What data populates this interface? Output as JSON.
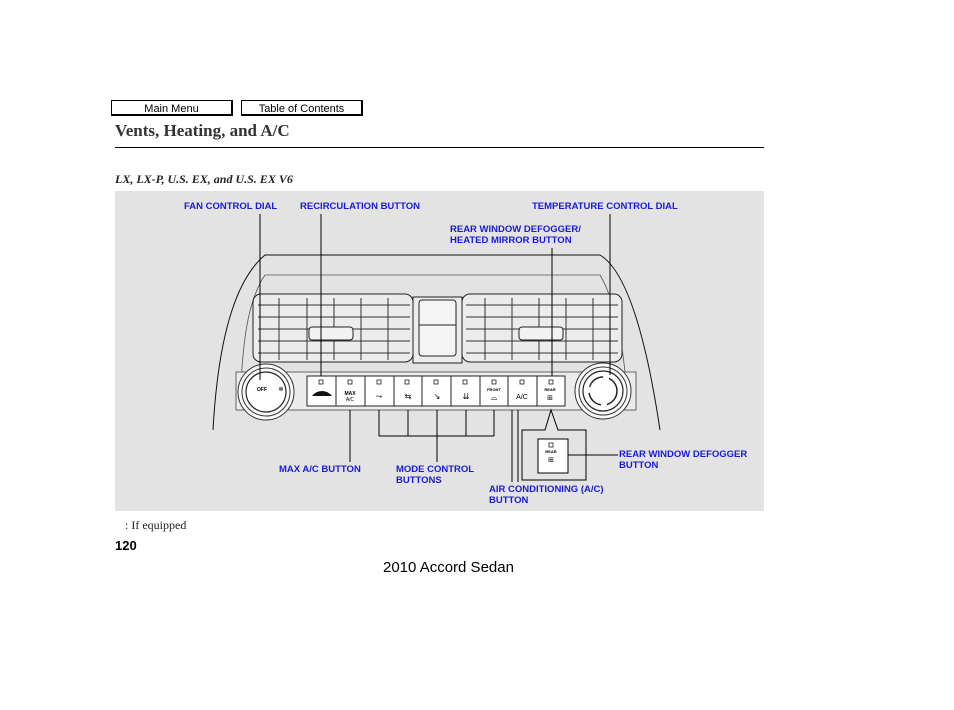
{
  "nav": {
    "main_menu": "Main Menu",
    "table_of_contents": "Table of Contents"
  },
  "page": {
    "title": "Vents, Heating, and A/C",
    "subtitle": "LX, LX-P, U.S. EX, and U.S. EX V6",
    "footnote": ":  If equipped",
    "page_number": "120",
    "footer": "2010 Accord Sedan"
  },
  "diagram": {
    "labels": {
      "fan_control_dial": "FAN CONTROL DIAL",
      "recirculation_button": "RECIRCULATION BUTTON",
      "temperature_control_dial": "TEMPERATURE CONTROL DIAL",
      "rear_defogger_mirror_1": "REAR WINDOW DEFOGGER/",
      "rear_defogger_mirror_2": "HEATED MIRROR BUTTON",
      "max_ac_button": "MAX A/C BUTTON",
      "mode_control_1": "MODE CONTROL",
      "mode_control_2": "BUTTONS",
      "air_conditioning_1": "AIR CONDITIONING (A/C)",
      "air_conditioning_2": "BUTTON",
      "rear_defogger_1": "REAR WINDOW DEFOGGER",
      "rear_defogger_2": "BUTTON"
    },
    "button_text": {
      "max": "MAX",
      "ac_small": "A/C",
      "front": "FRONT",
      "ac": "A/C",
      "rear": "REAR",
      "off": "OFF"
    },
    "label_color": "#1a1adb",
    "panel_color": "#e3e3e3"
  }
}
